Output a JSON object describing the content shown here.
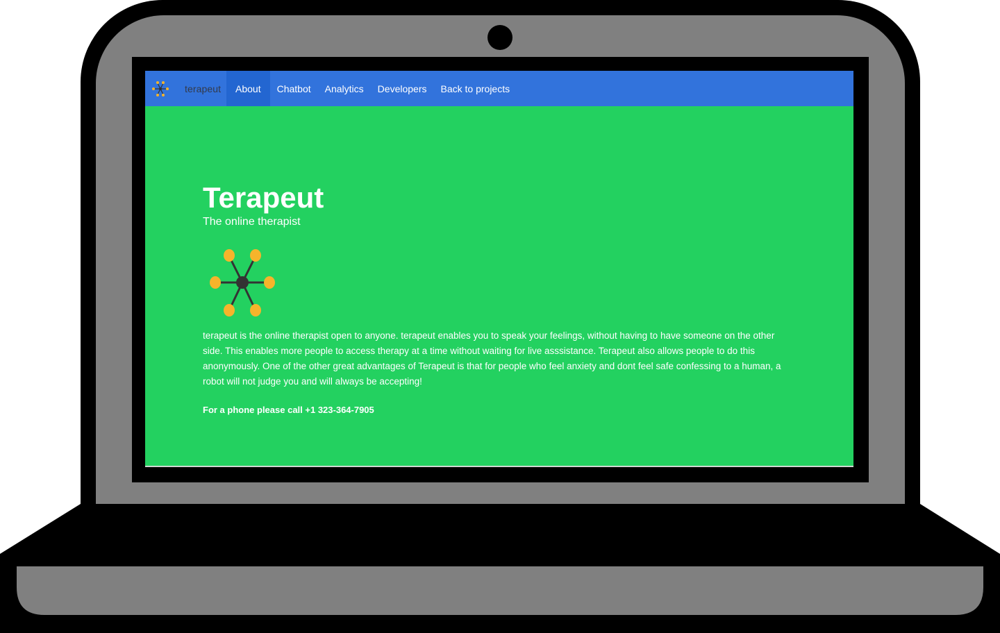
{
  "navbar": {
    "brand": "terapeut",
    "items": [
      {
        "label": "About",
        "active": true
      },
      {
        "label": "Chatbot",
        "active": false
      },
      {
        "label": "Analytics",
        "active": false
      },
      {
        "label": "Developers",
        "active": false
      },
      {
        "label": "Back to projects",
        "active": false
      }
    ]
  },
  "hero": {
    "title": "Terapeut",
    "subtitle": "The online therapist",
    "body": "terapeut is the online therapist open to anyone. terapeut enables you to speak your feelings, without having to have someone on the other side. This enables more people to access therapy at a time without waiting for live asssistance. Terapeut also allows people to do this anonymously. One of the other great advantages of Terapeut is that for people who feel anxiety and dont feel safe confessing to a human, a robot will not judge you and will always be accepting!",
    "contact": "For a phone please call +1 323-364-7905"
  },
  "colors": {
    "navbar": "#3273dc",
    "navbar_active": "#2366d1",
    "page_background": "#23d160",
    "logo_nodes": "#f6b42b",
    "logo_hub": "#333333",
    "laptop_frame": "#000000",
    "laptop_shell": "#808080"
  },
  "icons": {
    "brand_logo": "molecule-icon",
    "hero_logo": "molecule-icon",
    "webcam": "webcam-icon"
  }
}
